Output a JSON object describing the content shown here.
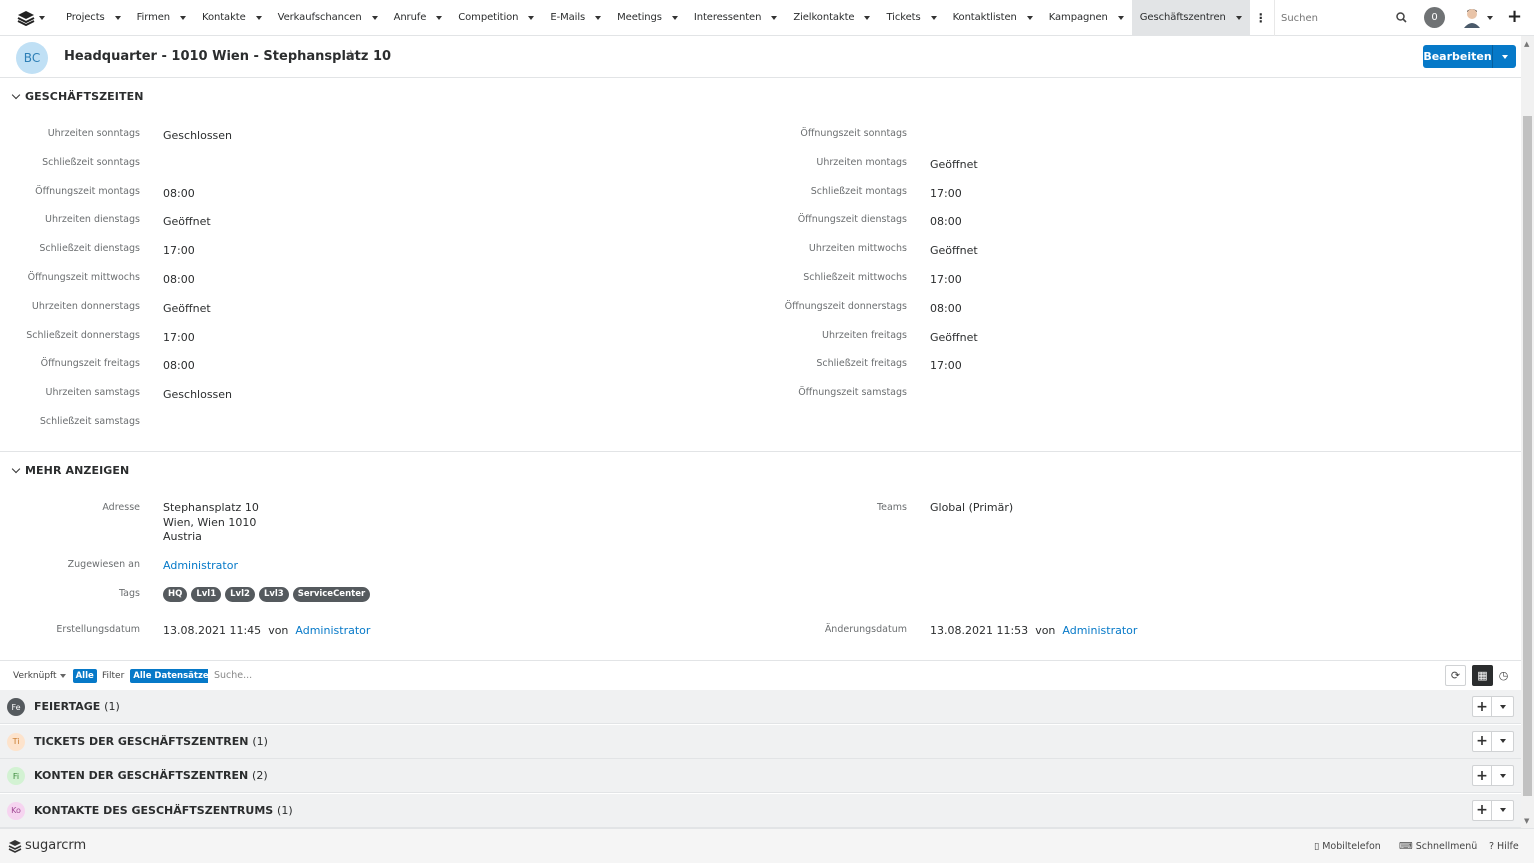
{
  "nav": {
    "items": [
      {
        "label": "Projects"
      },
      {
        "label": "Firmen"
      },
      {
        "label": "Kontakte"
      },
      {
        "label": "Verkaufschancen"
      },
      {
        "label": "Anrufe"
      },
      {
        "label": "Competition"
      },
      {
        "label": "E-Mails"
      },
      {
        "label": "Meetings"
      },
      {
        "label": "Interessenten"
      },
      {
        "label": "Zielkontakte"
      },
      {
        "label": "Tickets"
      },
      {
        "label": "Kontaktlisten"
      },
      {
        "label": "Kampagnen"
      },
      {
        "label": "Geschäftszentren"
      }
    ],
    "active_index": 13,
    "search_placeholder": "Suchen",
    "notification_count": "0"
  },
  "record": {
    "badge": "BC",
    "title": "Headquarter - 1010 Wien - Stephansplatz 10",
    "edit_label": "Bearbeiten"
  },
  "business_hours": {
    "heading": "GESCHÄFTSZEITEN",
    "left": [
      {
        "label": "Uhrzeiten sonntags",
        "value": "Geschlossen"
      },
      {
        "label": "Schließzeit sonntags",
        "value": ""
      },
      {
        "label": "Öffnungszeit montags",
        "value": "08:00"
      },
      {
        "label": "Uhrzeiten dienstags",
        "value": "Geöffnet"
      },
      {
        "label": "Schließzeit dienstags",
        "value": "17:00"
      },
      {
        "label": "Öffnungszeit mittwochs",
        "value": "08:00"
      },
      {
        "label": "Uhrzeiten donnerstags",
        "value": "Geöffnet"
      },
      {
        "label": "Schließzeit donnerstags",
        "value": "17:00"
      },
      {
        "label": "Öffnungszeit freitags",
        "value": "08:00"
      },
      {
        "label": "Uhrzeiten samstags",
        "value": "Geschlossen"
      },
      {
        "label": "Schließzeit samstags",
        "value": ""
      }
    ],
    "right": [
      {
        "label": "Öffnungszeit sonntags",
        "value": ""
      },
      {
        "label": "Uhrzeiten montags",
        "value": "Geöffnet"
      },
      {
        "label": "Schließzeit montags",
        "value": "17:00"
      },
      {
        "label": "Öffnungszeit dienstags",
        "value": "08:00"
      },
      {
        "label": "Uhrzeiten mittwochs",
        "value": "Geöffnet"
      },
      {
        "label": "Schließzeit mittwochs",
        "value": "17:00"
      },
      {
        "label": "Öffnungszeit donnerstags",
        "value": "08:00"
      },
      {
        "label": "Uhrzeiten freitags",
        "value": "Geöffnet"
      },
      {
        "label": "Schließzeit freitags",
        "value": "17:00"
      },
      {
        "label": "Öffnungszeit samstags",
        "value": ""
      }
    ]
  },
  "more": {
    "heading": "MEHR ANZEIGEN",
    "address_label": "Adresse",
    "address_lines": [
      "Stephansplatz 10",
      "Wien, Wien 1010",
      "Austria"
    ],
    "teams_label": "Teams",
    "teams_value": "Global (Primär)",
    "assigned_label": "Zugewiesen an",
    "assigned_value": "Administrator",
    "tags_label": "Tags",
    "tags": [
      "HQ",
      "Lvl1",
      "Lvl2",
      "Lvl3",
      "ServiceCenter"
    ],
    "created_label": "Erstellungsdatum",
    "created_value": "13.08.2021 11:45",
    "created_by_word": "von",
    "created_by": "Administrator",
    "modified_label": "Änderungsdatum",
    "modified_value": "13.08.2021 11:53",
    "modified_by_word": "von",
    "modified_by": "Administrator"
  },
  "toolbar": {
    "linked_label": "Verknüpft",
    "linked_value": "Alle",
    "filter_label": "Filter",
    "filter_value": "Alle Datensätze",
    "search_placeholder": "Suche..."
  },
  "subpanels": [
    {
      "icon": "Fe",
      "title": "FEIERTAGE",
      "count": "(1)",
      "icon_bg": "#555a5e",
      "icon_fg": "#ffffff"
    },
    {
      "icon": "Ti",
      "title": "TICKETS DER GESCHÄFTSZENTREN",
      "count": "(1)",
      "icon_bg": "#fde3cc",
      "icon_fg": "#c87a2d"
    },
    {
      "icon": "Fi",
      "title": "KONTEN DER GESCHÄFTSZENTREN",
      "count": "(2)",
      "icon_bg": "#d3f2d3",
      "icon_fg": "#3c8a3c"
    },
    {
      "icon": "Ko",
      "title": "KONTAKTE DES GESCHÄFTSZENTRUMS",
      "count": "(1)",
      "icon_bg": "#f6d4f0",
      "icon_fg": "#a04a94"
    }
  ],
  "footer": {
    "brand": "sugarcrm",
    "mobile": "Mobiltelefon",
    "quick_menu": "Schnellmenü",
    "help": "Hilfe"
  }
}
